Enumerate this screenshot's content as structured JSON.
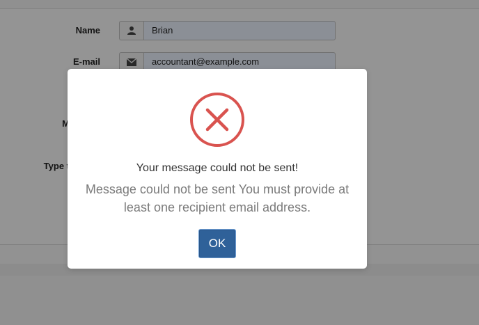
{
  "form": {
    "name_label": "Name",
    "name_value": "Brian",
    "email_label": "E-mail",
    "email_value": "accountant@example.com",
    "message_label_partial": "M",
    "type_label_partial": "Type t"
  },
  "modal": {
    "icon": "error-x-icon",
    "title": "Your message could not be sent!",
    "text": "Message could not be sent You must provide at least one recipient email address.",
    "ok_label": "OK"
  },
  "colors": {
    "error": "#d9534f",
    "ok_button": "#2f6199"
  }
}
